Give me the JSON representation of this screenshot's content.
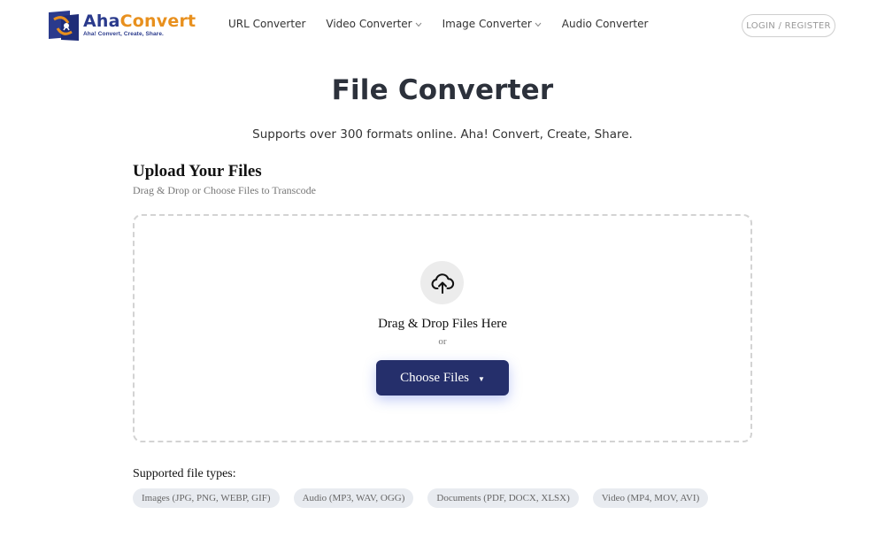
{
  "brand": {
    "name_part1": "Aha",
    "name_part2": "Convert",
    "tagline": "Aha! Convert, Create, Share."
  },
  "nav": {
    "items": [
      {
        "label": "URL Converter",
        "has_dropdown": false
      },
      {
        "label": "Video Converter",
        "has_dropdown": true
      },
      {
        "label": "Image Converter",
        "has_dropdown": true
      },
      {
        "label": "Audio Converter",
        "has_dropdown": false
      }
    ],
    "login_label": "LOGIN / REGISTER"
  },
  "hero": {
    "title": "File Converter",
    "subtitle": "Supports over 300 formats online. Aha! Convert, Create, Share."
  },
  "upload": {
    "heading": "Upload Your Files",
    "subheading": "Drag & Drop or Choose Files to Transcode",
    "drop_text": "Drag & Drop Files Here",
    "or_text": "or",
    "button_label": "Choose Files",
    "icon": "cloud-upload-icon"
  },
  "supported": {
    "label": "Supported file types:",
    "types": [
      "Images (JPG, PNG, WEBP, GIF)",
      "Audio (MP3, WAV, OGG)",
      "Documents (PDF, DOCX, XLSX)",
      "Video (MP4, MOV, AVI)"
    ]
  },
  "colors": {
    "brand_blue": "#2a3a8c",
    "brand_orange": "#e8901e",
    "button_bg": "#252f6b"
  }
}
